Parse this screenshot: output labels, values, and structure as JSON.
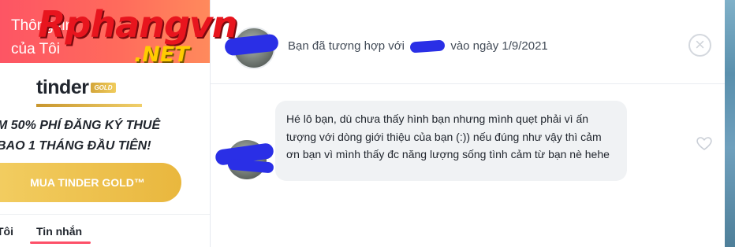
{
  "sidebar": {
    "header_title": "Thông tin của Tôi",
    "watermark": {
      "main": "Rphangvn",
      "sub": ".NET"
    },
    "brand": {
      "name": "tinder",
      "badge": "GOLD"
    },
    "promo_line1": "M 50% PHÍ ĐĂNG KÝ THUÊ",
    "promo_line2": "BAO 1 THÁNG ĐẦU TIÊN!",
    "gold_button_label": "MUA TINDER GOLD™",
    "tabs": [
      {
        "label": "Tôi"
      },
      {
        "label": "Tin nhắn",
        "active": true
      }
    ]
  },
  "match_header": {
    "prefix": "Bạn đã tương hợp với",
    "suffix": "vào ngày 1/9/2021"
  },
  "messages": [
    {
      "text": "Hé lô bạn, dù chưa thấy hình bạn nhưng mình quẹt phải vì ấn tượng với dòng giới thiệu của bạn (:)) nếu đúng như vậy thì cảm ơn bạn vì mình thấy đc năng lượng sống tình cảm từ bạn nè hehe"
    }
  ],
  "icons": {
    "close": "close-icon",
    "like": "heart-icon"
  },
  "colors": {
    "accent": "#fd5068",
    "gold": "#e9b73e",
    "redaction": "#2a2fe6"
  }
}
